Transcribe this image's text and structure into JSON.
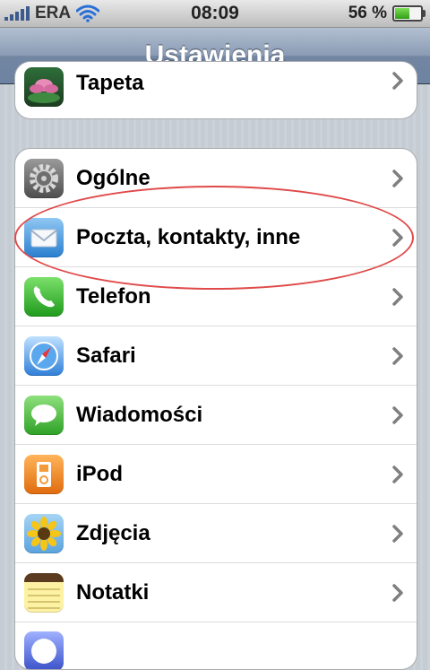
{
  "status_bar": {
    "carrier": "ERA",
    "time": "08:09",
    "battery_percent_text": "56 %",
    "battery_level": 0.56
  },
  "nav": {
    "title": "Ustawienia"
  },
  "top_group": {
    "items": [
      {
        "label": "Tapeta",
        "icon": "wallpaper-icon"
      }
    ]
  },
  "main_group": {
    "items": [
      {
        "label": "Ogólne",
        "icon": "gear-icon"
      },
      {
        "label": "Poczta, kontakty, inne",
        "icon": "mail-icon"
      },
      {
        "label": "Telefon",
        "icon": "phone-icon"
      },
      {
        "label": "Safari",
        "icon": "compass-icon"
      },
      {
        "label": "Wiadomości",
        "icon": "messages-icon"
      },
      {
        "label": "iPod",
        "icon": "ipod-icon"
      },
      {
        "label": "Zdjęcia",
        "icon": "sunflower-icon"
      },
      {
        "label": "Notatki",
        "icon": "notes-icon"
      }
    ]
  },
  "colors": {
    "nav_gradient_top": "#b3c0d1",
    "nav_gradient_bottom": "#6d83a1",
    "annotation": "#e04a4a",
    "chevron": "#7f7f7f"
  }
}
